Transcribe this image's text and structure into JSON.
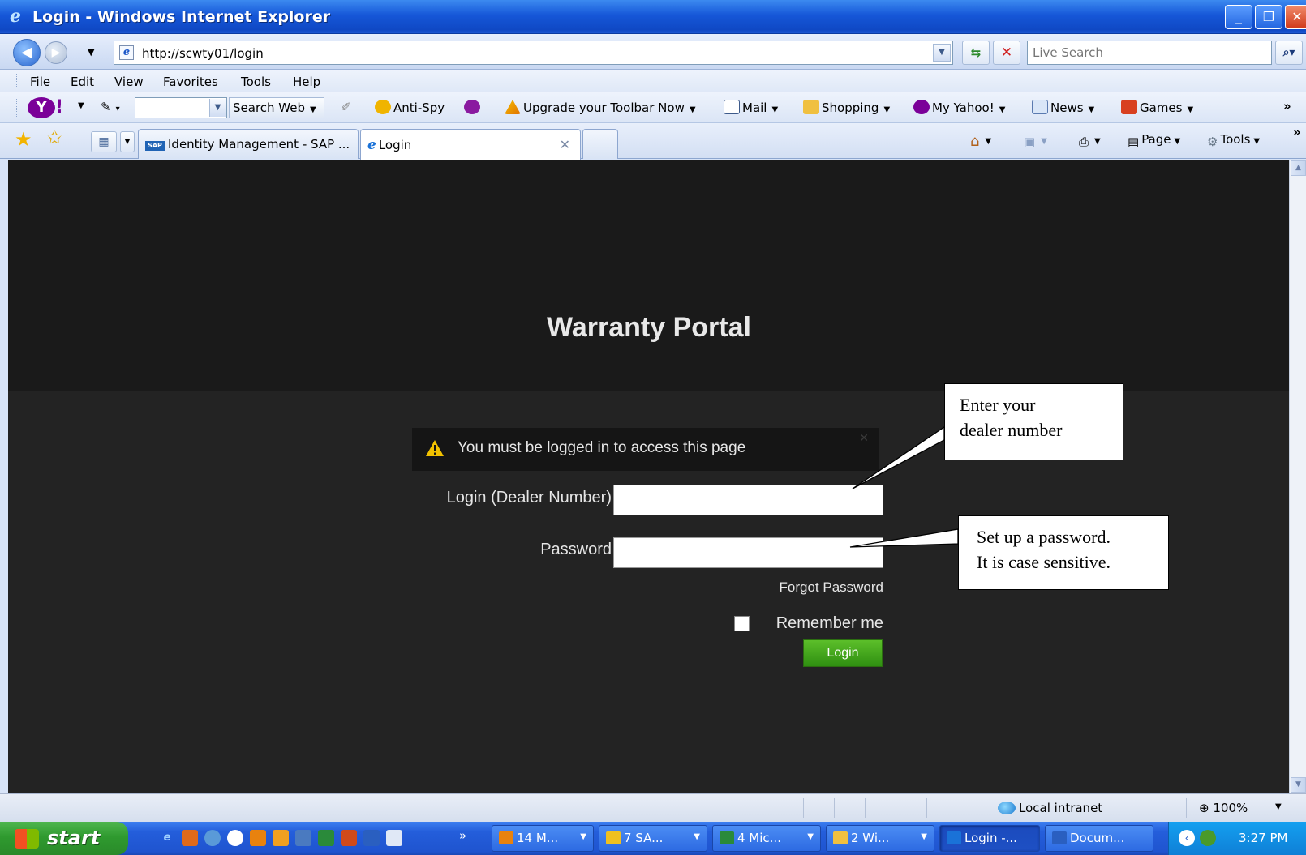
{
  "window": {
    "title": "Login - Windows Internet Explorer",
    "buttons": {
      "minimize": "_",
      "maximize": "❐",
      "close": "✕"
    }
  },
  "address_bar": {
    "url": "http://scwty01/login",
    "search_placeholder": "Live Search"
  },
  "menu": [
    "File",
    "Edit",
    "View",
    "Favorites",
    "Tools",
    "Help"
  ],
  "yahoo_toolbar": {
    "search_button": "Search Web",
    "items": [
      "Anti-Spy",
      "Upgrade your Toolbar Now",
      "Mail",
      "Shopping",
      "My Yahoo!",
      "News",
      "Games"
    ],
    "more": "»"
  },
  "tabs": [
    {
      "label": "Identity Management - SAP ...",
      "active": false
    },
    {
      "label": "Login",
      "active": true
    }
  ],
  "command_bar": {
    "page": "Page",
    "tools": "Tools"
  },
  "page": {
    "title": "Warranty Portal",
    "alert": "You must be logged in to access this page",
    "login_label": "Login (Dealer Number)",
    "password_label": "Password",
    "forgot_password": "Forgot Password",
    "remember_me": "Remember me",
    "login_button": "Login",
    "login_value": "",
    "password_value": ""
  },
  "callouts": {
    "dealer": [
      "Enter your",
      "dealer number"
    ],
    "password": [
      "Set up a password.",
      "It is case sensitive."
    ]
  },
  "status_bar": {
    "zone": "Local intranet",
    "zoom": "100%"
  },
  "taskbar": {
    "start": "start",
    "more": "»",
    "tasks": [
      {
        "label": "14 M...",
        "icon_color": "#e8820e"
      },
      {
        "label": "7 SA...",
        "icon_color": "#f0c020"
      },
      {
        "label": "4 Mic...",
        "icon_color": "#2a8a3a"
      },
      {
        "label": "2 Wi...",
        "icon_color": "#f0c040"
      },
      {
        "label": "Login -...",
        "icon_color": "#1a72d8"
      },
      {
        "label": "Docum...",
        "icon_color": "#2a5fc0"
      }
    ],
    "clock": "3:27 PM"
  },
  "colors": {
    "page_background": "#232323",
    "login_button": "#3fa01a",
    "titlebar": "#1657d8"
  }
}
